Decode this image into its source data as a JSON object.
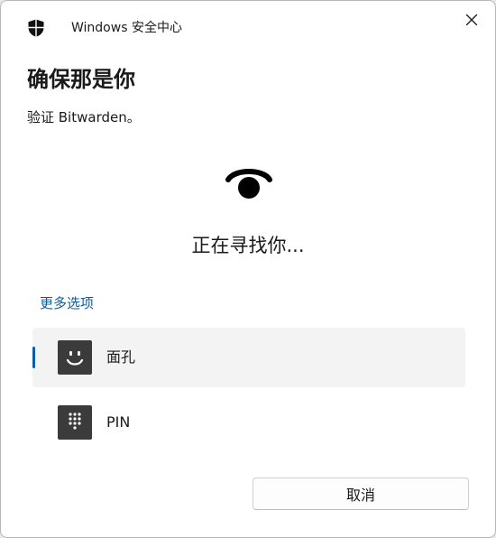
{
  "titlebar": {
    "app_title": "Windows 安全中心",
    "app_icon": "shield-icon",
    "close_icon": "close-icon"
  },
  "main": {
    "heading": "确保那是你",
    "subtext": "验证 Bitwarden。",
    "status_icon": "windows-hello-icon",
    "status_text": "正在寻找你...",
    "more_options_label": "更多选项"
  },
  "options": [
    {
      "label": "面孔",
      "icon": "face-icon",
      "selected": true
    },
    {
      "label": "PIN",
      "icon": "pin-keypad-icon",
      "selected": false
    }
  ],
  "footer": {
    "cancel_label": "取消"
  },
  "colors": {
    "accent": "#0a5ea8",
    "selected_bg": "#f3f3f3",
    "icon_tile": "#3b3b3b"
  }
}
